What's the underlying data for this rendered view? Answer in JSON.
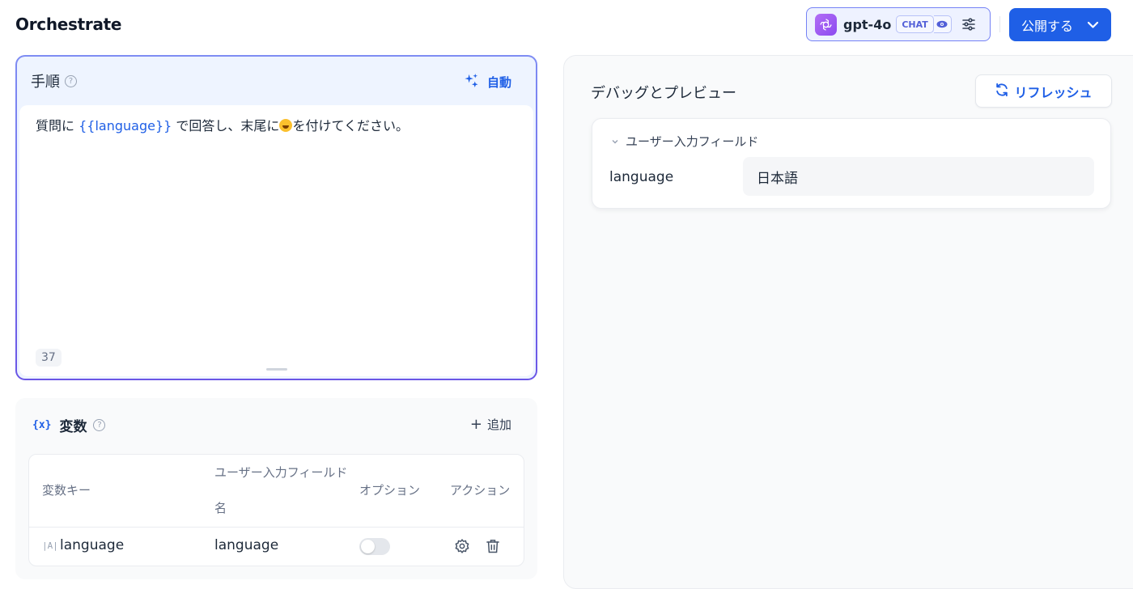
{
  "app": {
    "title": "Orchestrate"
  },
  "model": {
    "name": "gpt-4o",
    "mode_badge": "CHAT"
  },
  "publish": {
    "label": "公開する"
  },
  "prompt": {
    "title": "手順",
    "auto_label": "自動",
    "text_before": "質問に",
    "variable": "{{language}}",
    "text_after": "で回答し、末尾に",
    "text_end": "を付けてください。",
    "char_count": "37"
  },
  "variables": {
    "title": "変数",
    "icon_text": "{x}",
    "add_label": "追加",
    "columns": [
      "変数キー",
      "ユーザー入力フィールド名",
      "オプション",
      "アクション"
    ],
    "rows": [
      {
        "type_icon": "|A|",
        "key": "language",
        "field_name": "language",
        "optional": false
      }
    ]
  },
  "debug": {
    "title": "デバッグとプレビュー",
    "refresh_label": "リフレッシュ",
    "user_input_section": "ユーザー入力フィールド",
    "fields": [
      {
        "label": "language",
        "value": "日本語"
      }
    ]
  },
  "colors": {
    "accent": "#1f5fe6",
    "prompt_border": "#6a56e6",
    "model_logo": "#8c4af0"
  }
}
